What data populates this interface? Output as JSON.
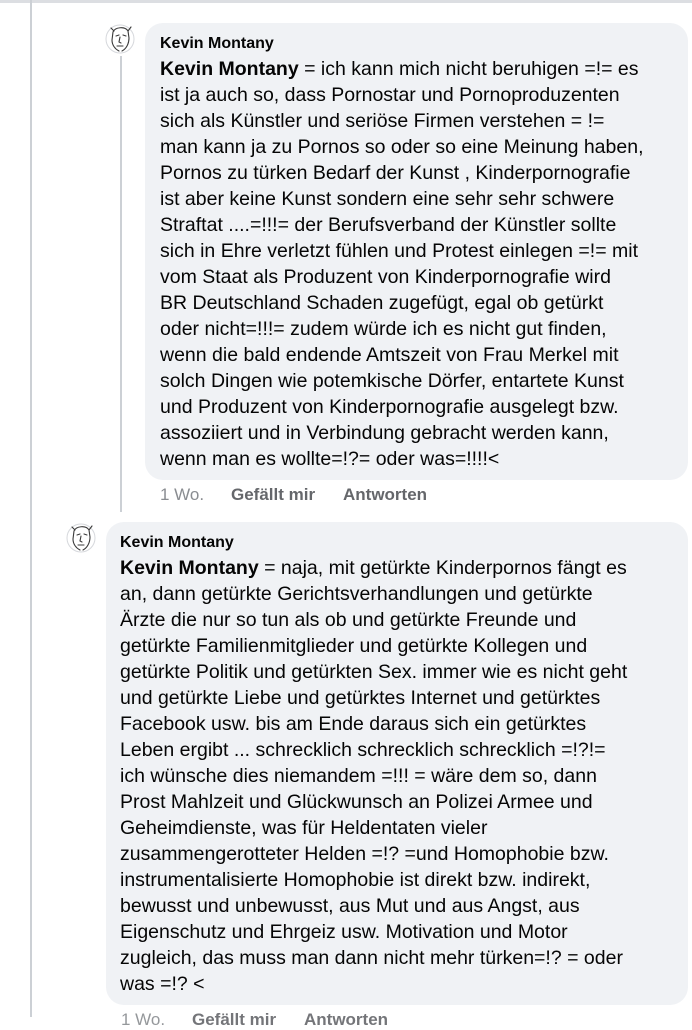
{
  "comments": [
    {
      "author": "Kevin Montany",
      "mention": "Kevin Montany",
      "lines": [
        " = ich kann mich nicht beruhigen =!= es",
        "ist ja auch so, dass Pornostar und Pornoproduzenten",
        "sich als Künstler und seriöse Firmen verstehen = !=",
        "man kann ja zu Pornos so oder so eine Meinung haben,",
        "Pornos zu türken Bedarf der Kunst , Kinderpornografie",
        "ist aber keine Kunst sondern eine sehr sehr schwere",
        "Straftat ....=!!!= der Berufsverband der Künstler sollte",
        "sich in Ehre verletzt fühlen und Protest einlegen =!= mit",
        "vom Staat als Produzent von  Kinderpornografie wird",
        "BR Deutschland Schaden zugefügt, egal ob getürkt",
        "oder nicht=!!!=  zudem würde ich es nicht gut finden,",
        "wenn die bald endende Amtszeit von Frau Merkel mit",
        "solch Dingen wie potemkische Dörfer, entartete Kunst",
        "und Produzent von Kinderpornografie ausgelegt bzw.",
        "assoziiert und  in Verbindung gebracht werden kann,",
        "wenn man es wollte=!?= oder was=!!!!<"
      ],
      "time": "1 Wo.",
      "like_label": "Gefällt mir",
      "reply_label": "Antworten"
    },
    {
      "author": "Kevin Montany",
      "mention": "Kevin Montany",
      "lines": [
        " = naja, mit getürkte Kinderpornos fängt es",
        "an, dann  getürkte Gerichtsverhandlungen und  getürkte",
        "Ärzte die nur so tun als ob und  getürkte Freunde und",
        "getürkte  Familienmitglieder und  getürkte Kollegen und",
        "getürkte Politik  und getürkten Sex. immer wie es nicht geht",
        "und getürkte Liebe und getürktes Internet und getürktes",
        "Facebook usw. bis am Ende daraus sich ein getürktes",
        "Leben ergibt ... schrecklich schrecklich schrecklich =!?!=",
        "ich wünsche dies niemandem =!!! = wäre dem so, dann",
        "Prost Mahlzeit und Glückwunsch an Polizei Armee und",
        "Geheimdienste, was für  Heldentaten vieler",
        "zusammengerotteter Helden =!? =und Homophobie bzw.",
        "instrumentalisierte Homophobie ist direkt bzw. indirekt,",
        "bewusst und unbewusst, aus Mut und aus Angst, aus",
        "Eigenschutz und Ehrgeiz usw. Motivation und Motor",
        "zugleich, das muss man dann nicht mehr türken=!? = oder",
        "was =!? <"
      ],
      "time": "1 Wo.",
      "like_label": "Gefällt mir",
      "reply_label": "Antworten"
    }
  ],
  "colors": {
    "bubble": "#f0f2f5",
    "text": "#050505",
    "meta": "#65676b",
    "thread_line": "#ccd0d5"
  },
  "icons": {
    "avatar": "sketch-face-avatar-icon"
  }
}
